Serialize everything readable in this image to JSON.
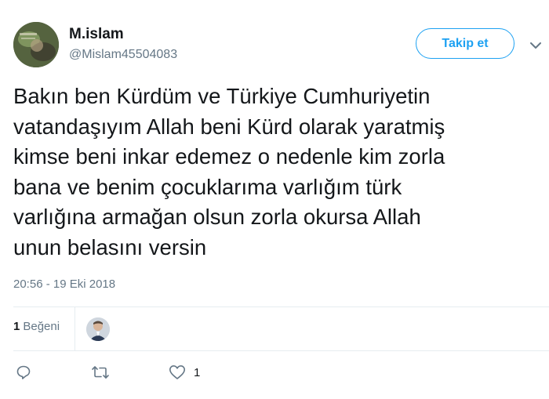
{
  "user": {
    "display_name": "M.islam",
    "handle": "@Mislam45504083",
    "avatar_icon": "profile-photo-icon"
  },
  "follow_button": {
    "label": "Takip et"
  },
  "menu_caret": {
    "icon": "chevron-down-icon"
  },
  "tweet": {
    "text": "Bakın ben Kürdüm ve Türkiye Cumhuriyetin\nvatandaşıyım Allah beni Kürd olarak yaratmiş\nkimse beni inkar edemez o nedenle kim zorla\nbana ve benim çocuklarıma varlığım türk\nvarlığına armağan olsun zorla okursa Allah\nunun belasını versin",
    "timestamp": "20:56 - 19 Eki 2018"
  },
  "engagement": {
    "likes_count": "1",
    "likes_label": "Beğeni",
    "liker_avatar_icon": "liker-avatar-icon"
  },
  "actions": {
    "reply_icon": "reply-icon",
    "retweet_icon": "retweet-icon",
    "like_icon": "heart-icon",
    "like_count": "1"
  },
  "colors": {
    "accent": "#1da1f2",
    "text": "#14171a",
    "secondary": "#657786",
    "divider": "#e6ecf0"
  }
}
